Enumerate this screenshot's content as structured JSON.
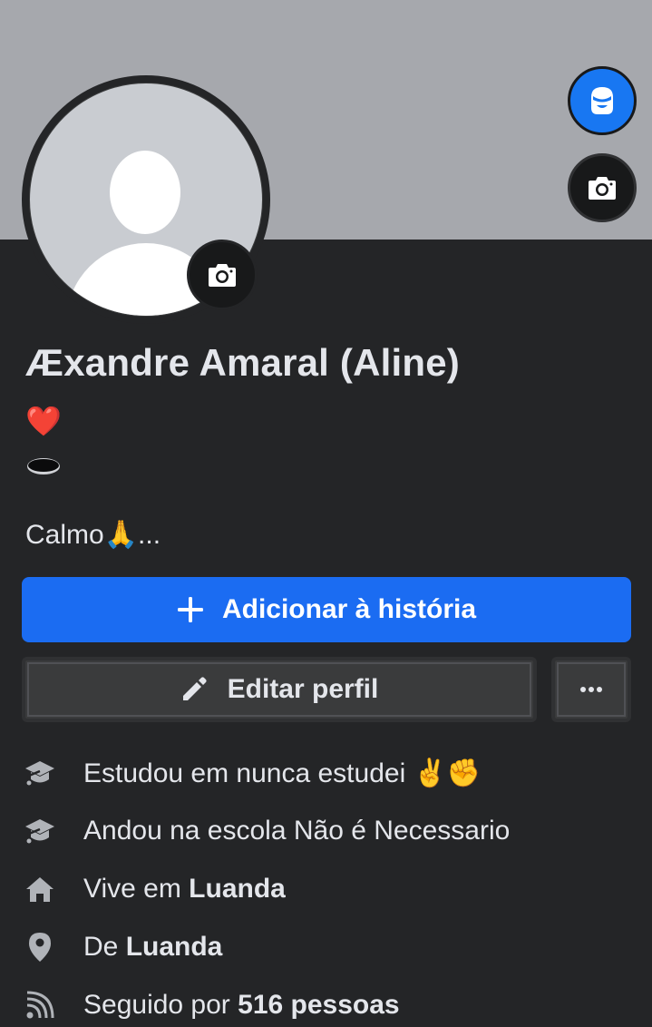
{
  "profile": {
    "name": "Æxandre Amaral (Aline)",
    "heart_emoji": "❤️",
    "hole_emoji": "🕳️",
    "bio": "Calmo🙏..."
  },
  "actions": {
    "add_story_label": "Adicionar à história",
    "edit_profile_label": "Editar perfil",
    "more_label": "..."
  },
  "details": [
    {
      "icon": "graduation-cap-icon",
      "prefix": "Estudou em nunca estudei ✌️✊",
      "bold": ""
    },
    {
      "icon": "graduation-cap-icon",
      "prefix": "Andou na escola Não é Necessario",
      "bold": ""
    },
    {
      "icon": "home-icon",
      "prefix": "Vive em ",
      "bold": "Luanda"
    },
    {
      "icon": "location-pin-icon",
      "prefix": "De ",
      "bold": "Luanda"
    },
    {
      "icon": "rss-feed-icon",
      "prefix": "Seguido por ",
      "bold": "516 pessoas"
    }
  ],
  "colors": {
    "background": "#242527",
    "cover": "#a6a8ad",
    "primary": "#1b6cf2",
    "secondary_button": "#3a3b3c",
    "text": "#e4e6eb",
    "icon": "#b0b3b8"
  }
}
